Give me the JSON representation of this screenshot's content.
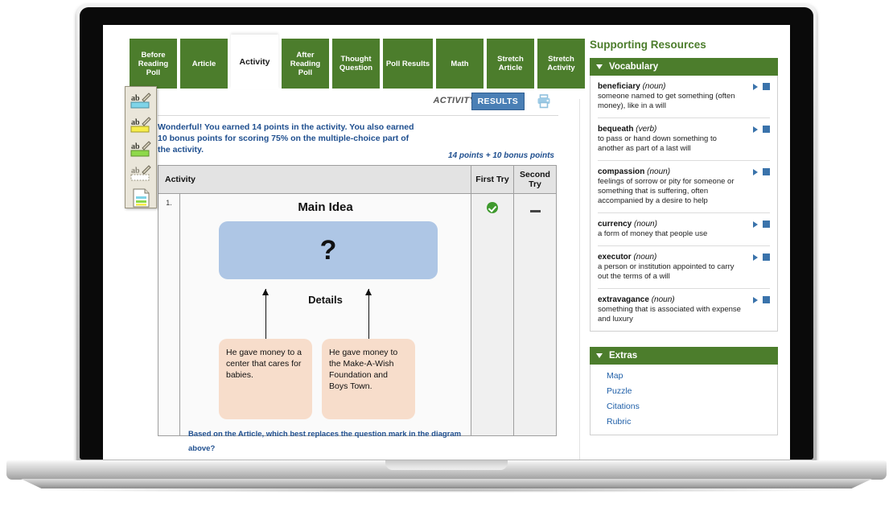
{
  "tabs": [
    {
      "label": "Before Reading Poll",
      "active": false
    },
    {
      "label": "Article",
      "active": false
    },
    {
      "label": "Activity",
      "active": true
    },
    {
      "label": "After Reading Poll",
      "active": false
    },
    {
      "label": "Thought Question",
      "active": false
    },
    {
      "label": "Poll Results",
      "active": false
    },
    {
      "label": "Math",
      "active": false
    },
    {
      "label": "Stretch Article",
      "active": false
    },
    {
      "label": "Stretch Activity",
      "active": false
    }
  ],
  "tool_palette": {
    "tools": [
      {
        "name": "highlighter-blue",
        "color": "#7fd4e8"
      },
      {
        "name": "highlighter-yellow",
        "color": "#f6ec4a"
      },
      {
        "name": "highlighter-green",
        "color": "#8ed94a"
      },
      {
        "name": "highlighter-clear",
        "color": "#ffffff"
      },
      {
        "name": "notes-page",
        "color": "#ffffff"
      }
    ]
  },
  "toolbar": {
    "activity_label": "ACTIVITY",
    "results_label": "RESULTS",
    "print_icon": "printer-icon",
    "results_active_color": "#4a7fb5"
  },
  "message": "Wonderful! You earned 14 points in the activity. You also earned 10 bonus points for scoring 75% on the multiple-choice part of the activity.",
  "points_summary": "14 points + 10 bonus points",
  "table": {
    "columns": [
      "Activity",
      "First Try",
      "Second Try"
    ],
    "rows": [
      {
        "number": "1.",
        "first_try": "correct",
        "second_try": "none",
        "diagram": {
          "main_idea_label": "Main Idea",
          "main_idea_value": "?",
          "main_idea_color": "#aec6e5",
          "details_label": "Details",
          "detail_boxes": [
            "He gave money to a center that cares for babies.",
            "He gave money to the Make-A-Wish Foundation and Boys Town."
          ],
          "detail_color": "#f7ddcb"
        },
        "question": "Based on the Article, which best replaces the question mark in the diagram above?"
      }
    ]
  },
  "sidebar": {
    "title": "Supporting Resources",
    "accent_color": "#4c7d2c",
    "vocabulary": {
      "header": "Vocabulary",
      "entries": [
        {
          "term": "beneficiary",
          "pos": "(noun)",
          "definition": "someone named to get something (often money), like in a will"
        },
        {
          "term": "bequeath",
          "pos": "(verb)",
          "definition": "to pass or hand down something to another as part of a last will"
        },
        {
          "term": "compassion",
          "pos": "(noun)",
          "definition": "feelings of sorrow or pity for someone or something that is suffering, often accompanied by a desire to help"
        },
        {
          "term": "currency",
          "pos": "(noun)",
          "definition": "a form of money that people use"
        },
        {
          "term": "executor",
          "pos": "(noun)",
          "definition": "a person or institution appointed to carry out the terms of a will"
        },
        {
          "term": "extravagance",
          "pos": "(noun)",
          "definition": "something that is associated with expense and luxury"
        }
      ]
    },
    "extras": {
      "header": "Extras",
      "links": [
        "Map",
        "Puzzle",
        "Citations",
        "Rubric"
      ]
    }
  }
}
